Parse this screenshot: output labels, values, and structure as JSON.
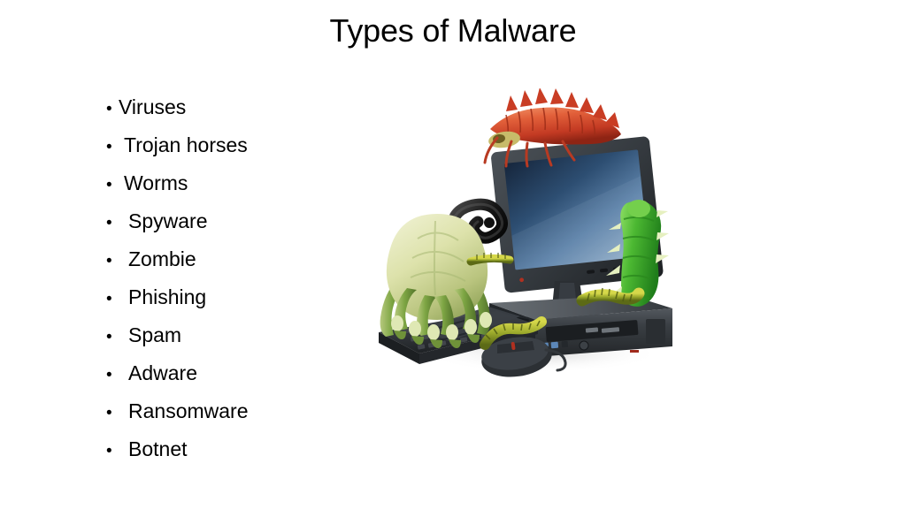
{
  "slide": {
    "title": "Types of Malware",
    "background_color": "#ffffff",
    "text_color": "#000000"
  },
  "bullets": [
    {
      "label": "Viruses",
      "marker": "•",
      "indent": "tight"
    },
    {
      "label": "Trojan horses",
      "marker": "•",
      "indent": "loose"
    },
    {
      "label": "Worms",
      "marker": "•",
      "indent": "loose"
    },
    {
      "label": "Spyware",
      "marker": "•",
      "indent": "looser"
    },
    {
      "label": "Zombie",
      "marker": "•",
      "indent": "looser"
    },
    {
      "label": "Phishing",
      "marker": "•",
      "indent": "looser"
    },
    {
      "label": "Spam",
      "marker": "•",
      "indent": "looser"
    },
    {
      "label": "Adware",
      "marker": "•",
      "indent": "looser"
    },
    {
      "label": "Ransomware",
      "marker": "•",
      "indent": "looser"
    },
    {
      "label": "Botnet",
      "marker": "•",
      "indent": "looser"
    }
  ],
  "picture": {
    "alt": "Desktop computer infested with bugs: monitor, tower, keyboard and mouse covered by a red centipede, a black snake, a pale green dust mite and green caterpillars",
    "parts": {
      "monitor": "monitor",
      "monitor_screen": "monitor-screen",
      "monitor_stand": "monitor-stand",
      "tower": "computer-tower",
      "keyboard": "keyboard",
      "mouse": "mouse",
      "red_centipede": "red-centipede-bug",
      "black_snake": "black-snake-bug",
      "dust_mite": "green-dust-mite-bug",
      "green_caterpillar": "green-caterpillar-bug",
      "small_caterpillars": "yellow-green-caterpillars"
    },
    "colors": {
      "screen_dark": "#182a43",
      "screen_light": "#6b8fb5",
      "bezel": "#3a3f44",
      "bezel_dark": "#202326",
      "case": "#2e3134",
      "case_light": "#4a4f54",
      "centipede_red": "#d6452c",
      "centipede_light": "#ef7a52",
      "snake_black": "#141414",
      "mite_body": "#d9dfa8",
      "mite_leg": "#7fa647",
      "caterpillar_green": "#55b93a",
      "caterpillar_yellow": "#bdbd2c"
    }
  }
}
